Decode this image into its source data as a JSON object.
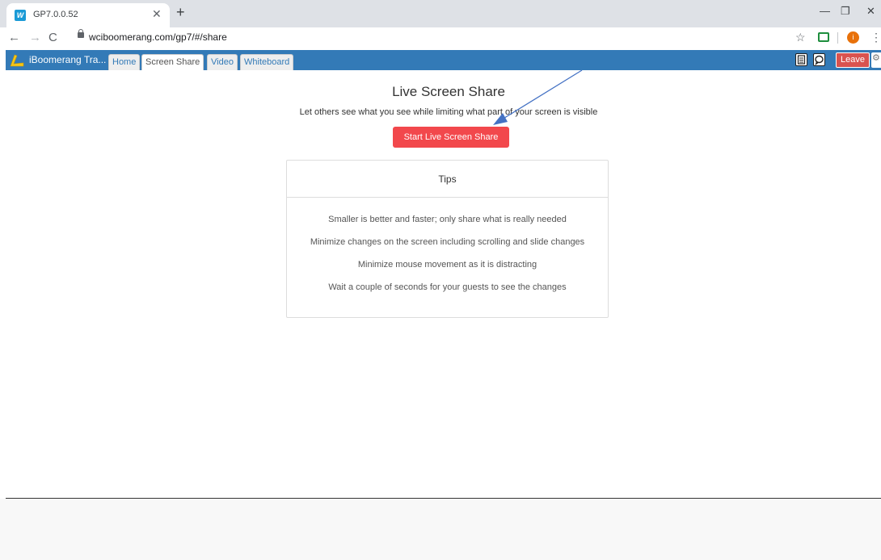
{
  "browser": {
    "tab_title": "GP7.0.0.52",
    "url": "wciboomerang.com/gp7/#/share",
    "profile_initial": "i"
  },
  "app": {
    "brand": "iBoomerang Tra...",
    "tabs": [
      "Home",
      "Screen Share",
      "Video",
      "Whiteboard"
    ],
    "active_tab": "Screen Share",
    "leave_label": "Leave"
  },
  "main": {
    "title": "Live Screen Share",
    "subtitle": "Let others see what you see while limiting what part of your screen is visible",
    "start_button": "Start Live Screen Share"
  },
  "tips": {
    "heading": "Tips",
    "items": [
      "Smaller is better and faster; only share what is really needed",
      "Minimize changes on the screen including scrolling and slide changes",
      "Minimize mouse movement as it is distracting",
      "Wait a couple of seconds for your guests to see the changes"
    ]
  },
  "colors": {
    "nav_bar": "#337ab7",
    "start_button": "#f2484c",
    "leave_button": "#d9534f",
    "annotation_arrow": "#4472c4"
  }
}
